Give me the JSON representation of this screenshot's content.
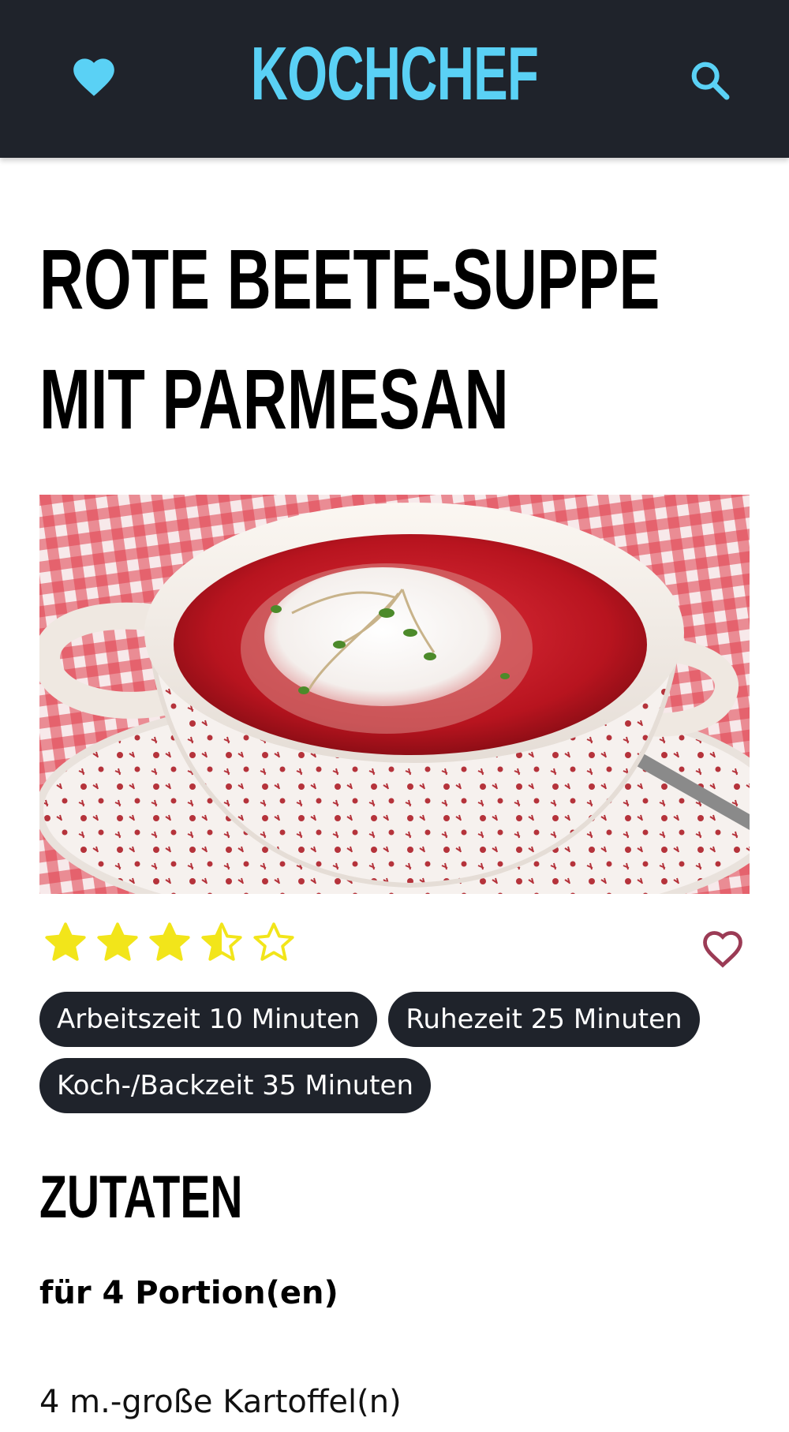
{
  "header": {
    "brand": "KOCHCHEF",
    "icons": [
      "heart-icon",
      "search-icon"
    ],
    "accent_color": "#5ad1f5",
    "background_color": "#1f232b"
  },
  "recipe": {
    "title_line_1": "ROTE BEETE-SUPPE",
    "title_line_2": "MIT PARMESAN",
    "image_icon": "soup-photo",
    "rating": {
      "value": 3.5,
      "max": 5,
      "star_color": "#f2e51a"
    },
    "like_icon": "heart-outline-icon",
    "like_color": "#9b3b55",
    "times": [
      {
        "label": "Arbeitszeit 10 Minuten"
      },
      {
        "label": "Ruhezeit 25 Minuten"
      },
      {
        "label": "Koch-/Backzeit 35 Minuten"
      }
    ]
  },
  "ingredients": {
    "heading": "ZUTATEN",
    "portions": "für 4 Portion(en)",
    "items": [
      "4 m.-große Kartoffel(n)"
    ]
  }
}
